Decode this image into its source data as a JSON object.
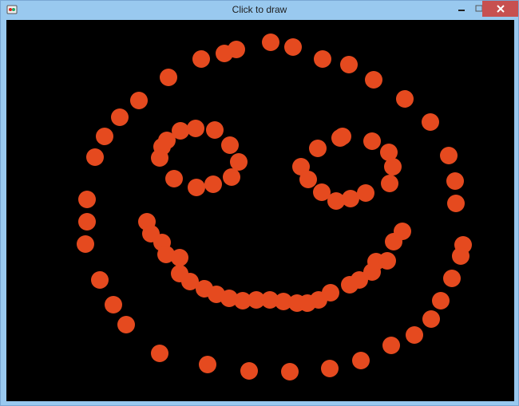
{
  "window": {
    "title": "Click to draw",
    "controls": {
      "minimize": "minimize-icon",
      "maximize": "maximize-icon",
      "close": "close-icon"
    }
  },
  "canvas": {
    "background": "#000000",
    "dot_color": "#e54a1f",
    "drawing": "smiley-face"
  }
}
